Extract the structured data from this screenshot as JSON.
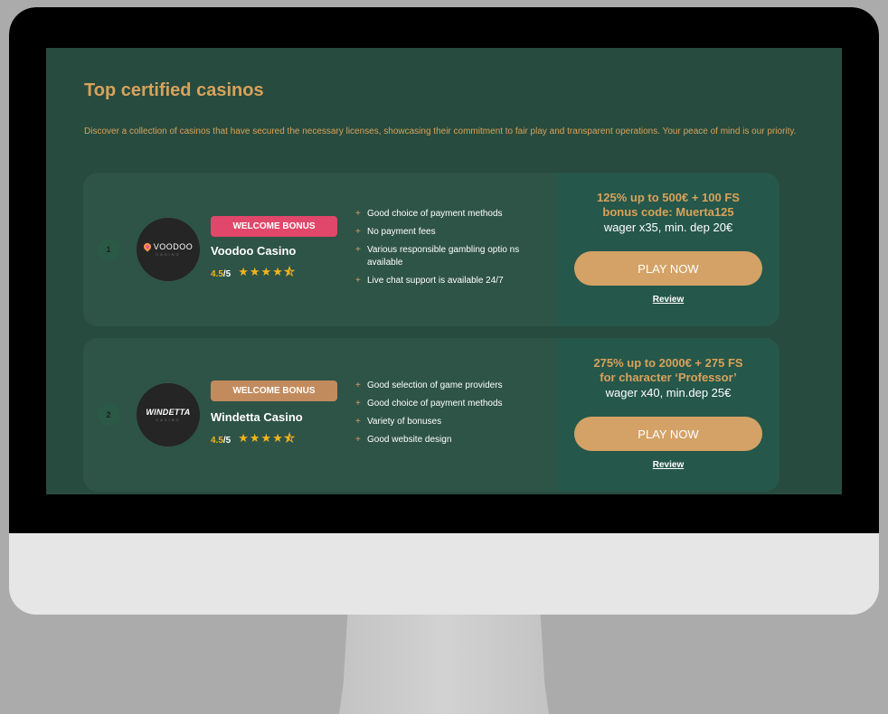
{
  "section": {
    "title": "Top certified casinos",
    "description": "Discover a collection of casinos that have secured the necessary licenses, showcasing their commitment to fair play and transparent operations. Your peace of mind is our priority."
  },
  "casinos": [
    {
      "rank": "1",
      "logo_text": "VOODOO",
      "logo_sub": "CASINO",
      "badge": "WELCOME BONUS",
      "badge_color": "#e0476a",
      "name": "Voodoo Casino",
      "score": "4.5",
      "score_max": "/5",
      "stars": "★★★★⯪",
      "features": [
        "Good choice of payment methods",
        "No payment fees",
        "Various responsible gambling optio ns available",
        "Live chat support is available 24/7"
      ],
      "offer_line1": "125% up to 500€ + 100 FS",
      "offer_line2": "bonus code: Muerta125",
      "offer_terms": "wager x35, min. dep 20€",
      "play_label": "PLAY NOW",
      "review_label": "Review"
    },
    {
      "rank": "2",
      "logo_text": "WINDETTA",
      "logo_sub": "CASINO",
      "badge": "WELCOME BONUS",
      "badge_color": "#c28b5e",
      "name": "Windetta Casino",
      "score": "4.5",
      "score_max": "/5",
      "stars": "★★★★⯪",
      "features": [
        "Good selection of game providers",
        "Good choice of payment methods",
        "Variety of bonuses",
        "Good website design"
      ],
      "offer_line1": "275% up to 2000€ + 275 FS",
      "offer_line2": "for character ‘Professor’",
      "offer_terms": "wager x40, min.dep 25€",
      "play_label": "PLAY NOW",
      "review_label": "Review"
    }
  ]
}
